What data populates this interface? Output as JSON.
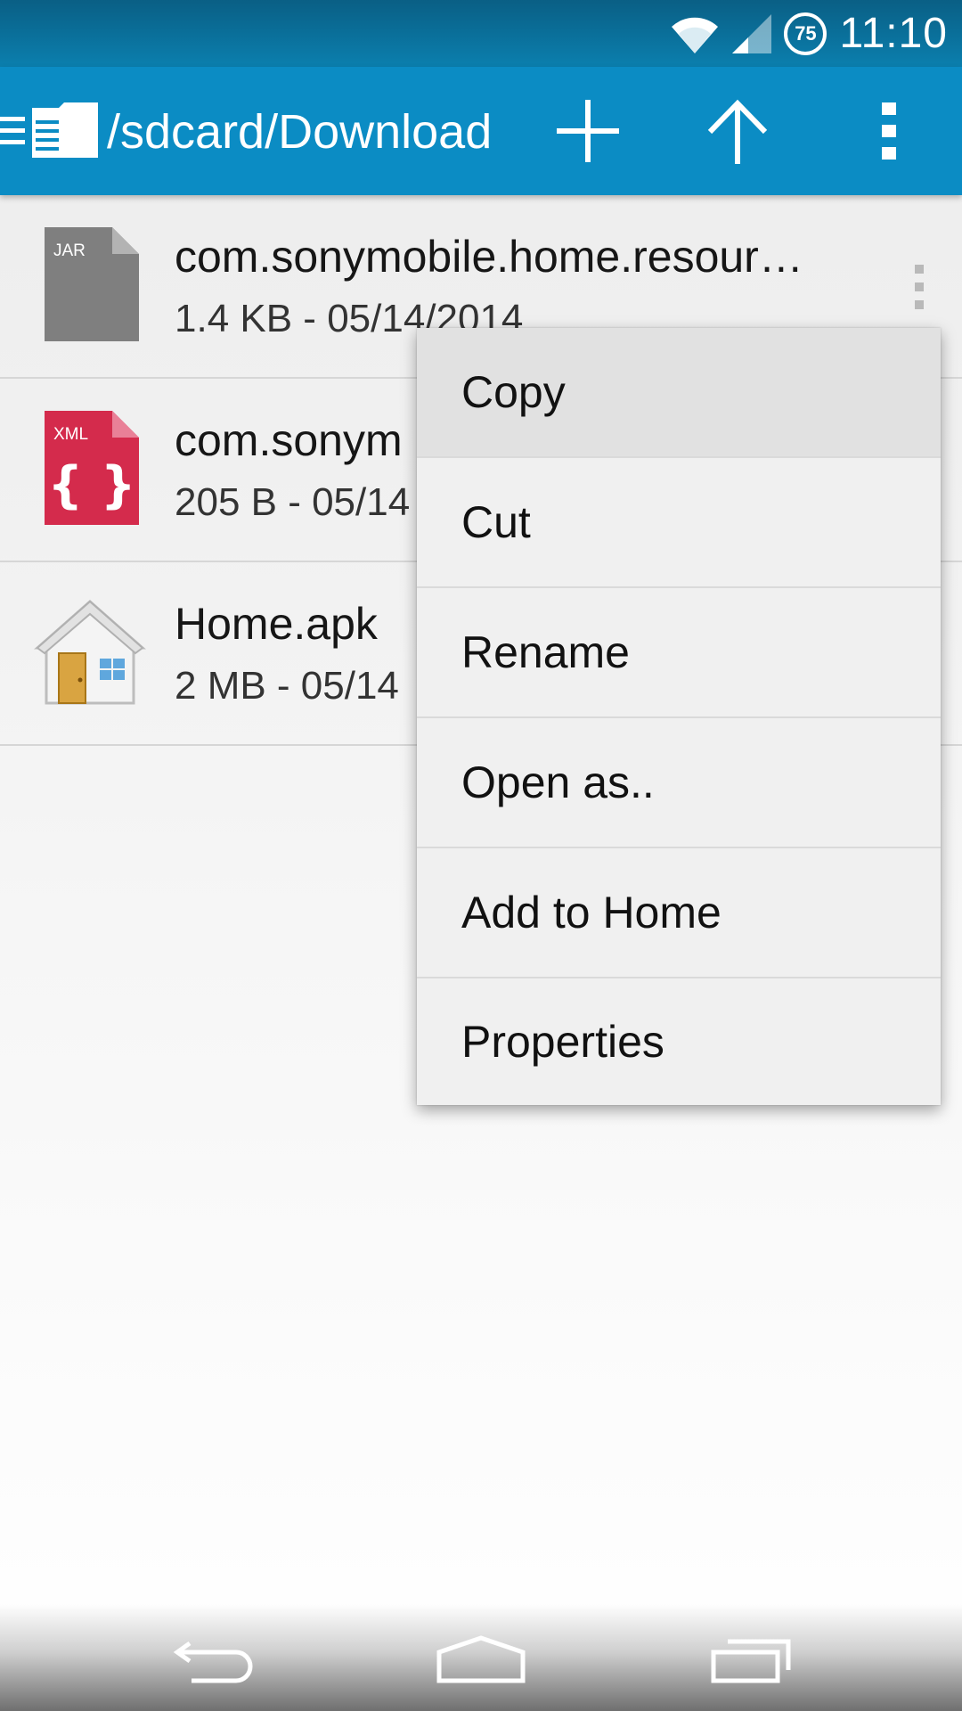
{
  "status_bar": {
    "time": "11:10",
    "battery_level": "75",
    "icons": [
      "wifi-icon",
      "cell-signal-icon",
      "battery-icon"
    ]
  },
  "action_bar": {
    "path": "/sdcard/Download",
    "icons": [
      "drawer-icon",
      "folder-icon",
      "add-icon",
      "up-arrow-icon",
      "overflow-menu-icon"
    ],
    "color": "#0b8cc4"
  },
  "files": [
    {
      "icon_label": "JAR",
      "name": "com.sonymobile.home.resour…",
      "meta": "1.4 KB - 05/14/2014",
      "icon": "jar-file-icon"
    },
    {
      "icon_label": "XML",
      "name": "com.sonym",
      "meta": "205 B - 05/14",
      "icon": "xml-file-icon"
    },
    {
      "name": "Home.apk",
      "meta": "2 MB - 05/14",
      "icon": "home-apk-icon"
    }
  ],
  "context_menu": {
    "items": [
      "Copy",
      "Cut",
      "Rename",
      "Open as..",
      "Add to Home",
      "Properties"
    ],
    "pressed_item": "Copy"
  },
  "nav_bar": {
    "icons": [
      "back-icon",
      "home-icon",
      "recents-icon"
    ]
  }
}
